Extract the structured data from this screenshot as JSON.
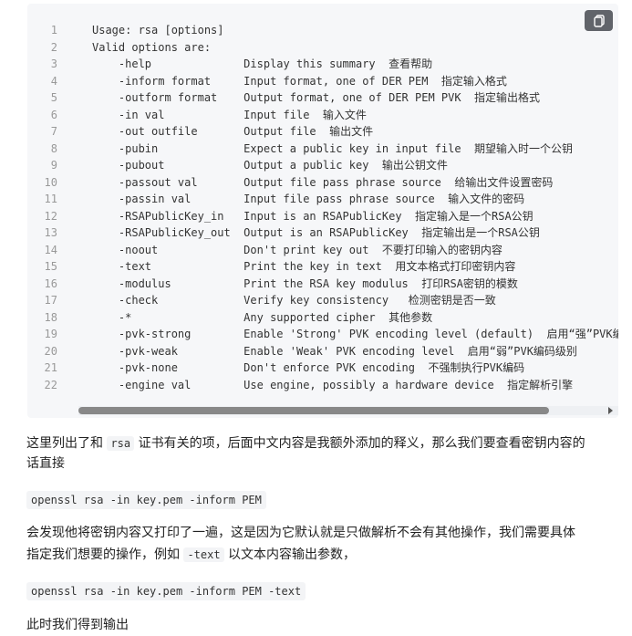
{
  "code_block": {
    "lines": [
      {
        "no": "1",
        "text": "Usage: rsa [options]"
      },
      {
        "no": "2",
        "text": "Valid options are:"
      },
      {
        "no": "3",
        "text": "    -help              Display this summary  查看帮助"
      },
      {
        "no": "4",
        "text": "    -inform format     Input format, one of DER PEM  指定输入格式"
      },
      {
        "no": "5",
        "text": "    -outform format    Output format, one of DER PEM PVK  指定输出格式"
      },
      {
        "no": "6",
        "text": "    -in val            Input file  输入文件"
      },
      {
        "no": "7",
        "text": "    -out outfile       Output file  输出文件"
      },
      {
        "no": "8",
        "text": "    -pubin             Expect a public key in input file  期望输入时一个公钥"
      },
      {
        "no": "9",
        "text": "    -pubout            Output a public key  输出公钥文件"
      },
      {
        "no": "10",
        "text": "    -passout val       Output file pass phrase source  给输出文件设置密码"
      },
      {
        "no": "11",
        "text": "    -passin val        Input file pass phrase source  输入文件的密码"
      },
      {
        "no": "12",
        "text": "    -RSAPublicKey_in   Input is an RSAPublicKey  指定输入是一个RSA公钥"
      },
      {
        "no": "13",
        "text": "    -RSAPublicKey_out  Output is an RSAPublicKey  指定输出是一个RSA公钥"
      },
      {
        "no": "14",
        "text": "    -noout             Don't print key out  不要打印输入的密钥内容"
      },
      {
        "no": "15",
        "text": "    -text              Print the key in text  用文本格式打印密钥内容"
      },
      {
        "no": "16",
        "text": "    -modulus           Print the RSA key modulus  打印RSA密钥的模数"
      },
      {
        "no": "17",
        "text": "    -check             Verify key consistency   检测密钥是否一致"
      },
      {
        "no": "18",
        "text": "    -*                 Any supported cipher  其他参数"
      },
      {
        "no": "19",
        "text": "    -pvk-strong        Enable 'Strong' PVK encoding level (default)  启用“强”PVK编码"
      },
      {
        "no": "20",
        "text": "    -pvk-weak          Enable 'Weak' PVK encoding level  启用“弱”PVK编码级别"
      },
      {
        "no": "21",
        "text": "    -pvk-none          Don't enforce PVK encoding  不强制执行PVK编码"
      },
      {
        "no": "22",
        "text": "    -engine val        Use engine, possibly a hardware device  指定解析引擎"
      }
    ],
    "copy_icon": "copy-icon"
  },
  "paragraphs": {
    "p1_line1_before": "这里列出了和 ",
    "p1_inline_code": "rsa",
    "p1_line1_after": " 证书有关的项，后面中文内容是我额外添加的释义，那么我们要查看密钥内容的",
    "p1_line2": "话直接",
    "cmd1": "openssl rsa -in key.pem -inform PEM",
    "p2_line1": "会发现他将密钥内容又打印了一遍，这是因为它默认就是只做解析不会有其他操作，我们需要具体",
    "p2_line2_before": "指定我们想要的操作，例如 ",
    "p2_inline_code": "-text",
    "p2_line2_after": " 以文本内容输出参数，",
    "cmd2": "openssl rsa -in key.pem -inform PEM -text",
    "p3": "此时我们得到输出"
  }
}
